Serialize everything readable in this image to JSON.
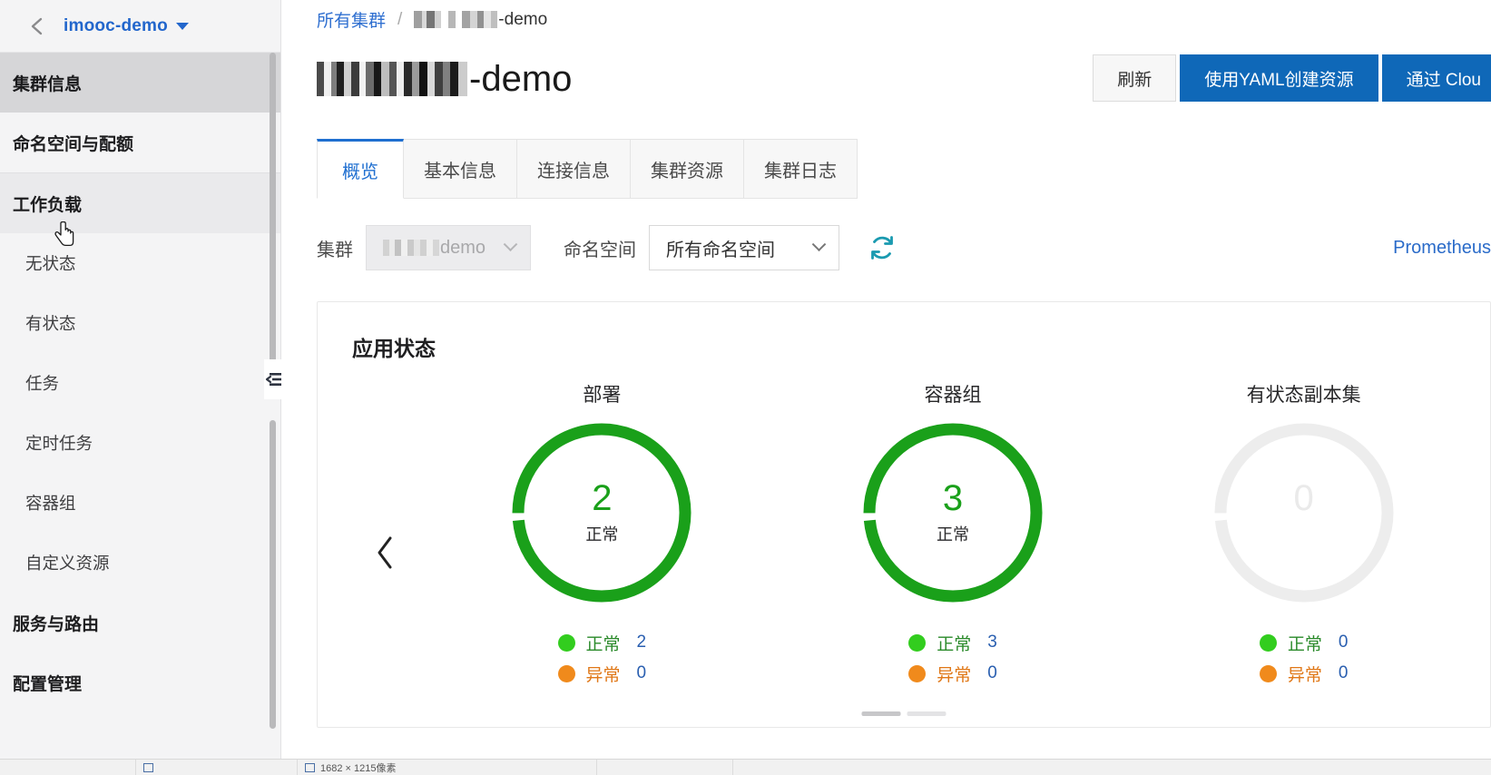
{
  "sidebar": {
    "back_icon": "chevron-left-icon",
    "cluster_name": "imooc-demo",
    "dropdown_icon": "caret-down-icon",
    "items": [
      {
        "label": "集群信息",
        "type": "group",
        "state": "active"
      },
      {
        "label": "命名空间与配额",
        "type": "group",
        "state": "normal"
      },
      {
        "label": "工作负载",
        "type": "group",
        "state": "hover"
      },
      {
        "label": "无状态",
        "type": "child",
        "state": "normal"
      },
      {
        "label": "有状态",
        "type": "child",
        "state": "normal"
      },
      {
        "label": "任务",
        "type": "child",
        "state": "normal"
      },
      {
        "label": "定时任务",
        "type": "child",
        "state": "normal"
      },
      {
        "label": "容器组",
        "type": "child",
        "state": "normal"
      },
      {
        "label": "自定义资源",
        "type": "child",
        "state": "normal"
      },
      {
        "label": "服务与路由",
        "type": "group",
        "state": "normal"
      },
      {
        "label": "配置管理",
        "type": "group",
        "state": "normal"
      }
    ],
    "collapse_icon": "collapse-panel-icon",
    "cursor_icon": "pointing-hand-cursor"
  },
  "breadcrumb": {
    "root_label": "所有集群",
    "separator": "/",
    "current_suffix": "-demo",
    "current_masked": true
  },
  "header": {
    "title_suffix": "-demo",
    "title_masked": true,
    "actions": [
      {
        "label": "刷新",
        "style": "default"
      },
      {
        "label": "使用YAML创建资源",
        "style": "primary"
      },
      {
        "label": "通过 Clou",
        "style": "primary"
      }
    ]
  },
  "tabs": [
    {
      "label": "概览",
      "active": true
    },
    {
      "label": "基本信息",
      "active": false
    },
    {
      "label": "连接信息",
      "active": false
    },
    {
      "label": "集群资源",
      "active": false
    },
    {
      "label": "集群日志",
      "active": false
    }
  ],
  "filters": {
    "cluster_label": "集群",
    "cluster_value_suffix": "demo",
    "cluster_value_masked": true,
    "cluster_disabled": true,
    "namespace_label": "命名空间",
    "namespace_value": "所有命名空间",
    "refresh_icon": "refresh-circular-arrows-icon",
    "prometheus_link": "Prometheus"
  },
  "card": {
    "title": "应用状态",
    "prev_icon": "chevron-left-icon",
    "pager": [
      {
        "active": true
      },
      {
        "active": false
      }
    ]
  },
  "colors": {
    "ring_green": "#1aa01a",
    "ring_empty": "#ededed",
    "dot_ok": "#32cd1e",
    "dot_err": "#f08a1c",
    "label_ok": "#2a8a2a",
    "label_err": "#e07818",
    "count_blue": "#2a5fb0",
    "primary_blue": "#0f68b8",
    "link_blue": "#2a6bc9",
    "refresh_teal": "#1a9ab0"
  },
  "chart_data": [
    {
      "type": "pie",
      "title": "部署",
      "center_value": "2",
      "center_label": "正常",
      "ring_filled": true,
      "legend_position": "bottom",
      "categories": [
        "正常",
        "异常"
      ],
      "values": [
        2,
        0
      ],
      "colors": [
        "#32cd1e",
        "#f08a1c"
      ]
    },
    {
      "type": "pie",
      "title": "容器组",
      "center_value": "3",
      "center_label": "正常",
      "ring_filled": true,
      "legend_position": "bottom",
      "categories": [
        "正常",
        "异常"
      ],
      "values": [
        3,
        0
      ],
      "colors": [
        "#32cd1e",
        "#f08a1c"
      ]
    },
    {
      "type": "pie",
      "title": "有状态副本集",
      "center_value": "0",
      "center_label": "正常",
      "ring_filled": false,
      "legend_position": "bottom",
      "categories": [
        "正常",
        "异常"
      ],
      "values": [
        0,
        0
      ],
      "colors": [
        "#32cd1e",
        "#f08a1c"
      ]
    }
  ],
  "statusbar": {
    "cell1": "",
    "cell2": "",
    "cell3": "1682 × 1215像素",
    "cell4": "",
    "icon": "image-dimensions-icon"
  }
}
